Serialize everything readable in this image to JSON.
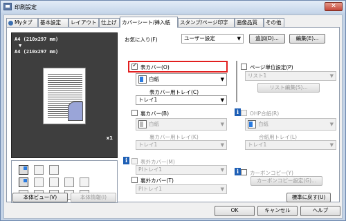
{
  "window": {
    "title": "印刷設定"
  },
  "tabs": [
    "Myタブ",
    "基本設定",
    "レイアウト",
    "仕上げ",
    "カバーシート/挿入紙",
    "スタンプ/ページ印字",
    "画像品質",
    "その他"
  ],
  "preview": {
    "line1": "A4 (210x297 mm)",
    "arrow": "▼",
    "line2": "A4 (210x297 mm)",
    "count": "x1"
  },
  "favorites": {
    "label": "お気に入り(F)",
    "value": "ユーザー設定",
    "add": "追加(D)...",
    "edit": "編集(E)..."
  },
  "front_cover": {
    "label": "表カバー(O)",
    "checked": true,
    "paper": "白紙",
    "tray_label": "表カバー用トレイ(C)",
    "tray": "トレイ1"
  },
  "back_cover": {
    "label": "裏カバー(B)",
    "checked": false,
    "paper": "白紙",
    "tray_label": "裏カバー用トレイ(K)",
    "tray": "トレイ1"
  },
  "page_unit": {
    "label": "ページ単位設定(P)",
    "list": "リスト1",
    "edit": "リスト編集(S)..."
  },
  "ohp": {
    "label": "OHP合紙(R)",
    "paper": "白紙",
    "tray_label": "合紙用トレイ(L)",
    "tray": "トレイ1"
  },
  "front_insert": {
    "label": "表外カバー(M)",
    "tray": "PIトレイ1"
  },
  "back_insert": {
    "label": "裏外カバー(T)",
    "tray": "PIトレイ1"
  },
  "carbon": {
    "label": "カーボンコピー(Y)",
    "button": "カーボンコピー設定(G)..."
  },
  "bottom": {
    "view": "本体ビュー(V)",
    "info": "本体情報(I)",
    "default": "標準に戻す(U)",
    "ok": "OK",
    "cancel": "キャンセル",
    "help": "ヘルプ"
  },
  "colors": {
    "accent": "#e21f1f",
    "info": "#1e5fb5"
  }
}
